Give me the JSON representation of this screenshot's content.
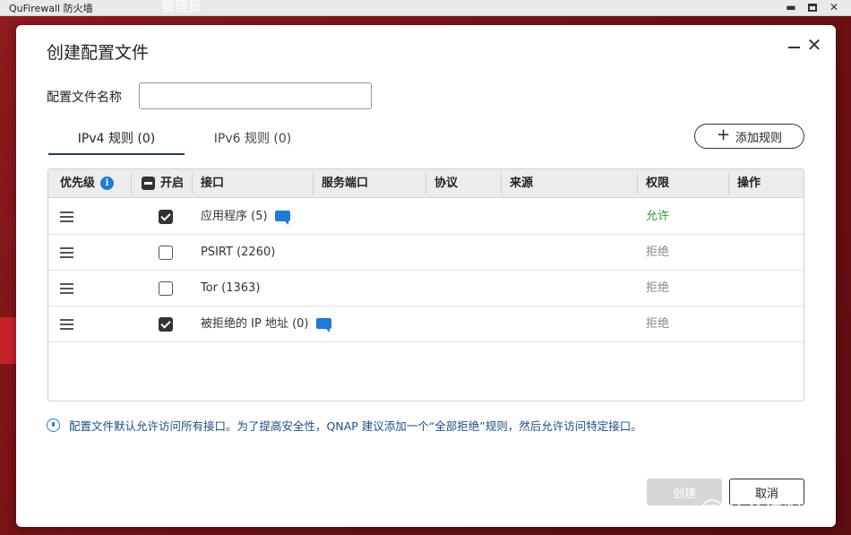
{
  "window": {
    "app_title": "QuFirewall 防火墙",
    "ghost_title": "管理员"
  },
  "dialog": {
    "title": "创建配置文件",
    "name_label": "配置文件名称",
    "name_value": ""
  },
  "tabs": [
    {
      "label": "IPv4 规则 (0)",
      "active": true
    },
    {
      "label": "IPv6 规则 (0)",
      "active": false
    }
  ],
  "add_rule_label": "添加规则",
  "table": {
    "columns": [
      "优先级",
      "开启",
      "接口",
      "服务端口",
      "协议",
      "来源",
      "权限",
      "操作"
    ],
    "rows": [
      {
        "enabled": true,
        "interface": "应用程序 (5)",
        "has_note": true,
        "permission": "允许",
        "permission_type": "allow"
      },
      {
        "enabled": false,
        "interface": "PSIRT (2260)",
        "has_note": false,
        "permission": "拒绝",
        "permission_type": "deny"
      },
      {
        "enabled": false,
        "interface": "Tor (1363)",
        "has_note": false,
        "permission": "拒绝",
        "permission_type": "deny"
      },
      {
        "enabled": true,
        "interface": "被拒绝的 IP 地址 (0)",
        "has_note": true,
        "permission": "拒绝",
        "permission_type": "deny"
      }
    ]
  },
  "notice": "配置文件默认允许访问所有接口。为了提高安全性，QNAP 建议添加一个“全部拒绝”规则，然后允许访问特定接口。",
  "buttons": {
    "create": "创建",
    "cancel": "取消"
  },
  "watermark": "什么值得买",
  "watermark_glyph": "值",
  "colors": {
    "accent": "#1f7ad8",
    "allow": "#2a9a2a",
    "deny": "#888888",
    "backdrop": "#7a1418"
  }
}
